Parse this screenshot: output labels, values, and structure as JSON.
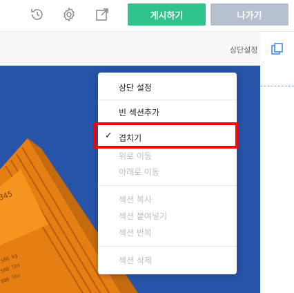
{
  "toolbar": {
    "history_icon": "history-icon",
    "settings_icon": "gear-icon",
    "external_icon": "external-link-icon",
    "publish_label": "게시하기",
    "exit_label": "나가기"
  },
  "section_header": {
    "label": "상단설정",
    "copy_icon": "copy-icon"
  },
  "context_menu": {
    "items": [
      {
        "label": "상단 설정",
        "disabled": false
      },
      {
        "label": "빈 섹션추가",
        "disabled": false
      },
      {
        "label": "겹치기",
        "disabled": false,
        "checked": true
      },
      {
        "label": "위로 이동",
        "disabled": true
      },
      {
        "label": "아래로 이동",
        "disabled": true
      },
      {
        "label": "섹션 복사",
        "disabled": true
      },
      {
        "label": "섹션 붙여넣기",
        "disabled": true
      },
      {
        "label": "섹션 반복",
        "disabled": true
      },
      {
        "label": "섹션 삭제",
        "disabled": true
      }
    ],
    "check_mark": "✓"
  },
  "colors": {
    "publish": "#2ec48b",
    "exit": "#b6c0cf",
    "canvas_bg": "#2754a8",
    "container": "#f08a1c",
    "highlight": "#ff0000"
  }
}
